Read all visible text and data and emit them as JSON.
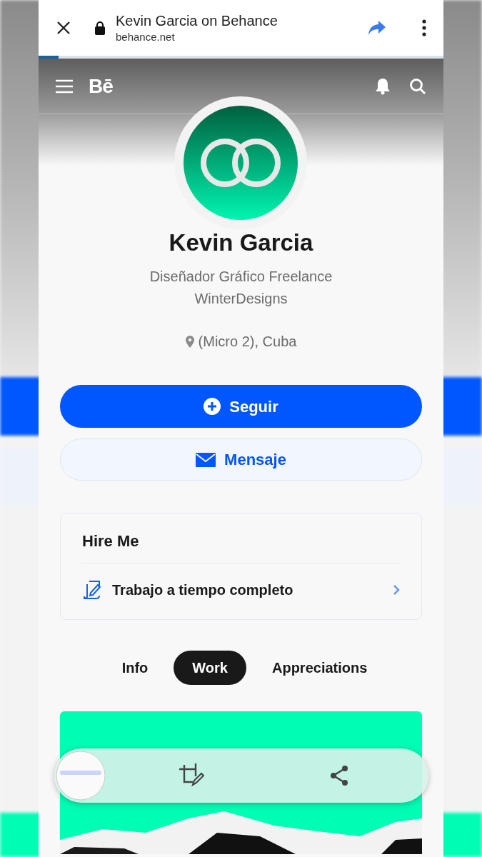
{
  "browser": {
    "title": "Kevin Garcia on Behance",
    "url": "behance.net",
    "level": 0.05
  },
  "site": {
    "logo": "Bē"
  },
  "profile": {
    "name": "Kevin Garcia",
    "headline": [
      "Diseñador Gráfico Freelance",
      "WinterDesigns"
    ],
    "location": "(Micro 2), Cuba"
  },
  "actions": [
    {
      "kind": "follow",
      "label": "Seguir"
    },
    {
      "kind": "message",
      "label": "Mensaje"
    }
  ],
  "hire": {
    "title": "Hire Me",
    "items": [
      "Trabajo a tiempo completo"
    ]
  },
  "tabs": [
    {
      "label": "Info",
      "selected": false
    },
    {
      "label": "Work",
      "selected": true
    },
    {
      "label": "Appreciations",
      "selected": false
    }
  ]
}
